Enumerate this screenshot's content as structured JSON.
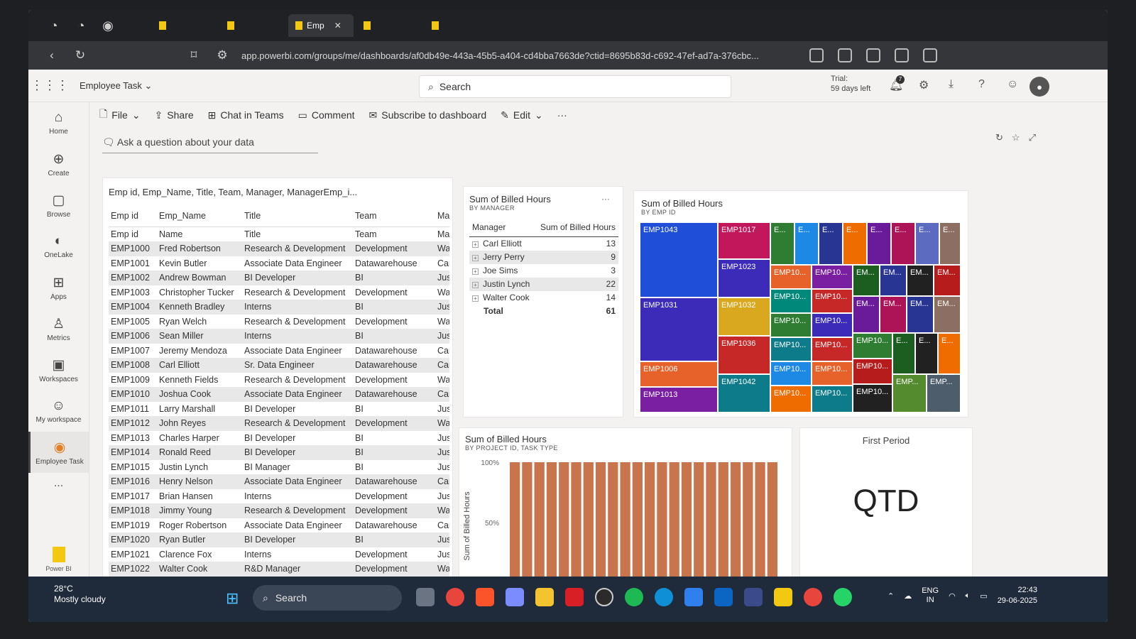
{
  "browser": {
    "tabs": [
      {
        "label": "",
        "active": false
      },
      {
        "label": "",
        "active": false
      },
      {
        "label": "Emp",
        "active": true
      },
      {
        "label": "",
        "active": false
      },
      {
        "label": "",
        "active": false
      }
    ],
    "url": "app.powerbi.com/groups/me/dashboards/af0db49e-443a-45b5-a404-cd4bba7663de?ctid=8695b83d-c692-47ef-ad7a-376cbc..."
  },
  "header": {
    "workspace": "Employee Task",
    "search_placeholder": "Search",
    "trial_label": "Trial:",
    "trial_days": "59 days left",
    "notification_count": "7"
  },
  "rail": {
    "items": [
      {
        "label": "Home",
        "icon": "home-icon"
      },
      {
        "label": "Create",
        "icon": "plus-circle-icon"
      },
      {
        "label": "Browse",
        "icon": "folder-icon"
      },
      {
        "label": "OneLake",
        "icon": "onelake-icon"
      },
      {
        "label": "Apps",
        "icon": "apps-icon"
      },
      {
        "label": "Metrics",
        "icon": "trophy-icon"
      },
      {
        "label": "Workspaces",
        "icon": "workspaces-icon"
      },
      {
        "label": "My workspace",
        "icon": "person-icon"
      },
      {
        "label": "Employee Task",
        "icon": "workspace-icon",
        "active": true
      }
    ],
    "more": "...",
    "app_label": "Power BI"
  },
  "toolbar": {
    "file": "File",
    "share": "Share",
    "chat": "Chat in Teams",
    "comment": "Comment",
    "subscribe": "Subscribe to dashboard",
    "edit": "Edit",
    "more": "···"
  },
  "qna": {
    "placeholder": "Ask a question about your data"
  },
  "emp_table": {
    "title": "Emp id, Emp_Name, Title, Team, Manager, ManagerEmp_i...",
    "headers": [
      "Emp id",
      "Emp_Name",
      "Title",
      "Team",
      "Ma"
    ],
    "rows": [
      [
        "Emp id",
        "Name",
        "Title",
        "Team",
        "Ma"
      ],
      [
        "EMP1000",
        "Fred Robertson",
        "Research & Development",
        "Development",
        "Wa"
      ],
      [
        "EMP1001",
        "Kevin Butler",
        "Associate Data Engineer",
        "Datawarehouse",
        "Car"
      ],
      [
        "EMP1002",
        "Andrew Bowman",
        "BI Developer",
        "BI",
        "Jus"
      ],
      [
        "EMP1003",
        "Christopher Tucker",
        "Research & Development",
        "Development",
        "Wa"
      ],
      [
        "EMP1004",
        "Kenneth Bradley",
        "Interns",
        "BI",
        "Jus"
      ],
      [
        "EMP1005",
        "Ryan Welch",
        "Research & Development",
        "Development",
        "Wa"
      ],
      [
        "EMP1006",
        "Sean Miller",
        "Interns",
        "BI",
        "Jus"
      ],
      [
        "EMP1007",
        "Jeremy Mendoza",
        "Associate Data Engineer",
        "Datawarehouse",
        "Car"
      ],
      [
        "EMP1008",
        "Carl Elliott",
        "Sr. Data Engineer",
        "Datawarehouse",
        "Car"
      ],
      [
        "EMP1009",
        "Kenneth Fields",
        "Research & Development",
        "Development",
        "Wa"
      ],
      [
        "EMP1010",
        "Joshua Cook",
        "Associate Data Engineer",
        "Datawarehouse",
        "Car"
      ],
      [
        "EMP1011",
        "Larry Marshall",
        "BI Developer",
        "BI",
        "Jus"
      ],
      [
        "EMP1012",
        "John Reyes",
        "Research & Development",
        "Development",
        "Wa"
      ],
      [
        "EMP1013",
        "Charles Harper",
        "BI Developer",
        "BI",
        "Jus"
      ],
      [
        "EMP1014",
        "Ronald Reed",
        "BI Developer",
        "BI",
        "Jus"
      ],
      [
        "EMP1015",
        "Justin Lynch",
        "BI Manager",
        "BI",
        "Jus"
      ],
      [
        "EMP1016",
        "Henry Nelson",
        "Associate Data Engineer",
        "Datawarehouse",
        "Car"
      ],
      [
        "EMP1017",
        "Brian Hansen",
        "Interns",
        "Development",
        "Jus"
      ],
      [
        "EMP1018",
        "Jimmy Young",
        "Research & Development",
        "Development",
        "Wa"
      ],
      [
        "EMP1019",
        "Roger Robertson",
        "Associate Data Engineer",
        "Datawarehouse",
        "Car"
      ],
      [
        "EMP1020",
        "Ryan Butler",
        "BI Developer",
        "BI",
        "Jus"
      ],
      [
        "EMP1021",
        "Clarence Fox",
        "Interns",
        "Development",
        "Jus"
      ],
      [
        "EMP1022",
        "Walter Cook",
        "R&D Manager",
        "Development",
        "Wa"
      ]
    ]
  },
  "mgr_table": {
    "title": "Sum of Billed Hours",
    "subtitle": "BY MANAGER",
    "headers": [
      "Manager",
      "Sum of Billed Hours"
    ],
    "rows": [
      [
        "Carl Elliott",
        "13"
      ],
      [
        "Jerry Perry",
        "9"
      ],
      [
        "Joe Sims",
        "3"
      ],
      [
        "Justin Lynch",
        "22"
      ],
      [
        "Walter Cook",
        "14"
      ]
    ],
    "total_label": "Total",
    "total_value": "61",
    "menu": "···"
  },
  "treemap": {
    "title": "Sum of Billed Hours",
    "subtitle": "BY EMP ID",
    "colors": [
      "#1f4fd8",
      "#c2185b",
      "#3b2bb8",
      "#e6622a",
      "#7a1fa2",
      "#d9a81e",
      "#c62828",
      "#0d7b8a",
      "#2e7d32",
      "#1e88e5",
      "#f9a825",
      "#283593",
      "#6a1b9a",
      "#ad1457",
      "#5c6bc0",
      "#8d6e63",
      "#00897b",
      "#ef6c00",
      "#1b5e20",
      "#212121",
      "#b71c1c",
      "#558b2f",
      "#4e5d6c"
    ]
  },
  "bar_chart": {
    "title": "Sum of Billed Hours",
    "subtitle": "BY PROJECT ID, TASK TYPE",
    "ylabel": "Sum of Billed Hours",
    "ticks": [
      "100%",
      "50%"
    ],
    "color": "#c8744d"
  },
  "chart_data": {
    "type": "bar",
    "title": "Sum of Billed Hours",
    "subtitle": "BY PROJECT ID, TASK TYPE",
    "ylabel": "Sum of Billed Hours",
    "ylim": [
      0,
      100
    ],
    "categories": [
      "",
      "",
      "",
      "",
      "",
      "",
      "",
      "",
      "",
      "",
      "",
      "",
      "",
      "",
      "",
      "",
      "",
      "",
      "",
      "",
      "",
      ""
    ],
    "values": [
      100,
      100,
      100,
      100,
      100,
      100,
      100,
      100,
      100,
      100,
      100,
      100,
      100,
      100,
      100,
      100,
      100,
      100,
      100,
      100,
      100,
      100
    ]
  },
  "qtd_card": {
    "title": "First Period",
    "value": "QTD"
  },
  "taskbar": {
    "temp": "28°C",
    "weather": "Mostly cloudy",
    "search": "Search",
    "lang1": "ENG",
    "lang2": "IN",
    "time": "22:43",
    "date": "29-06-2025"
  }
}
